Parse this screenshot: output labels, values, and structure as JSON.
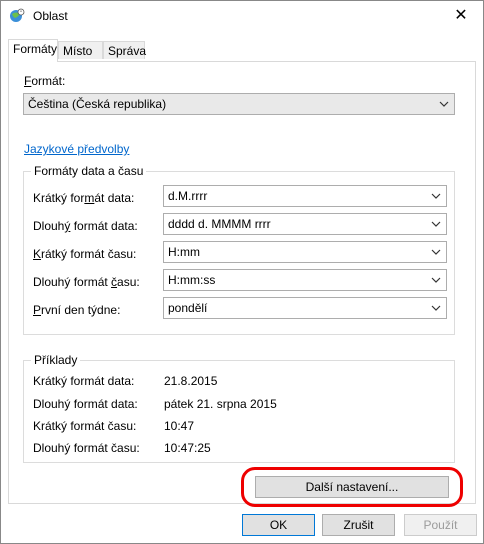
{
  "window": {
    "title": "Oblast",
    "close_glyph": "✕"
  },
  "tabs": [
    {
      "label": "Formáty",
      "active": true
    },
    {
      "label": "Místo"
    },
    {
      "label": "Správa"
    }
  ],
  "format": {
    "label_pre": "",
    "label_key": "F",
    "label_post": "ormát:",
    "value": "Čeština (Česká republika)"
  },
  "lang_link": "Jazykové předvolby",
  "datetime_group": {
    "title": "Formáty data a času",
    "rows": [
      {
        "pre": "Krátký for",
        "key": "m",
        "post": "át data:",
        "value": "d.M.rrrr"
      },
      {
        "pre": "Dlouh",
        "key": "ý",
        "post": " formát data:",
        "value": "dddd d. MMMM rrrr"
      },
      {
        "pre": "",
        "key": "K",
        "post": "rátký formát času:",
        "value": "H:mm"
      },
      {
        "pre": "Dlouhý formát ",
        "key": "č",
        "post": "asu:",
        "value": "H:mm:ss"
      },
      {
        "pre": "",
        "key": "P",
        "post": "rvní den týdne:",
        "value": "pondělí"
      }
    ]
  },
  "examples": {
    "title": "Příklady",
    "rows": [
      {
        "label": "Krátký formát data:",
        "value": "21.8.2015"
      },
      {
        "label": "Dlouhý formát data:",
        "value": "pátek 21. srpna 2015"
      },
      {
        "label": "Krátký formát času:",
        "value": "10:47"
      },
      {
        "label": "Dlouhý formát času:",
        "value": "10:47:25"
      }
    ]
  },
  "buttons": {
    "more_settings": "Další nastavení...",
    "ok": "OK",
    "cancel": "Zrušit",
    "apply": "Použít"
  },
  "icons": {
    "app": "globe-clock-icon",
    "dropdown": "chevron-down-icon"
  }
}
